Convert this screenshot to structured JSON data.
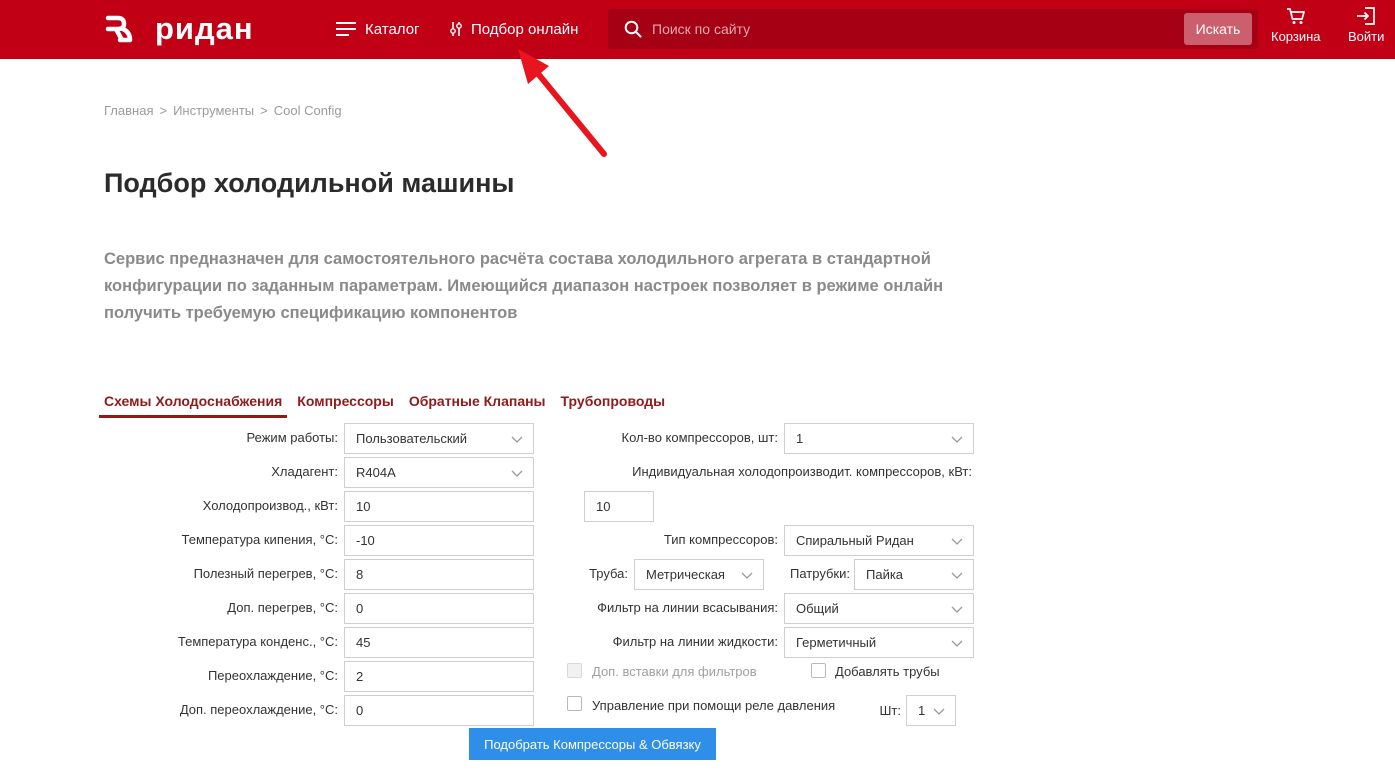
{
  "header": {
    "logo_text": "ридан",
    "nav": {
      "catalog": "Каталог",
      "online": "Подбор онлайн"
    },
    "search": {
      "placeholder": "Поиск по сайту",
      "button": "Искать"
    },
    "cart": "Корзина",
    "login": "Войти",
    "brand_color": "#c10016"
  },
  "breadcrumb": [
    "Главная",
    "Инструменты",
    "Cool Config"
  ],
  "breadcrumb_sep": ">",
  "page_title": "Подбор холодильной машины",
  "intro": "Сервис предназначен для самостоятельного расчёта состава холодильного агрегата в стандартной конфигурации по заданным параметрам. Имеющийся диапазон настроек позволяет в режиме онлайн получить требуемую спецификацию компонентов",
  "tabs": [
    "Схемы Холодоснабжения",
    "Компрессоры",
    "Обратные Клапаны",
    "Трубопроводы"
  ],
  "form_left": [
    {
      "label": "Режим работы:",
      "value": "Пользовательский",
      "type": "select"
    },
    {
      "label": "Хладагент:",
      "value": "R404A",
      "type": "select"
    },
    {
      "label": "Холодопроизвод., кВт:",
      "value": "10",
      "type": "input"
    },
    {
      "label": "Температура кипения, °С:",
      "value": "-10",
      "type": "input"
    },
    {
      "label": "Полезный перегрев, °С:",
      "value": "8",
      "type": "input"
    },
    {
      "label": "Доп. перегрев, °С:",
      "value": "0",
      "type": "input"
    },
    {
      "label": "Температура конденс., °С:",
      "value": "45",
      "type": "input"
    },
    {
      "label": "Переохлаждение, °С:",
      "value": "2",
      "type": "input"
    },
    {
      "label": "Доп. переохлаждение, °С:",
      "value": "0",
      "type": "input"
    }
  ],
  "form_right": {
    "compressor_count": {
      "label": "Кол-во компрессоров, шт:",
      "value": "1"
    },
    "individual_capacity": {
      "label": "Индивидуальная холодопроизводит. компрессоров, кВт:",
      "value": "10"
    },
    "compressor_type": {
      "label": "Тип компрессоров:",
      "value": "Спиральный Ридан"
    },
    "pipe": {
      "label": "Труба:",
      "value": "Метрическая"
    },
    "fittings": {
      "label": "Патрубки:",
      "value": "Пайка"
    },
    "suction_filter": {
      "label": "Фильтр на линии всасывания:",
      "value": "Общий"
    },
    "liquid_filter": {
      "label": "Фильтр на линии жидкости:",
      "value": "Герметичный"
    },
    "filter_inserts": {
      "label": "Доп. вставки для фильтров",
      "checked": false,
      "disabled": true
    },
    "add_pipes": {
      "label": "Добавлять трубы",
      "checked": false
    },
    "pressure_relay": {
      "label": "Управление при помощи реле давления",
      "checked": false
    },
    "qty": {
      "label": "Шт:",
      "value": "1"
    }
  },
  "submit": "Подобрать Компрессоры & Обвязку",
  "annotation_color": "#e8141e"
}
